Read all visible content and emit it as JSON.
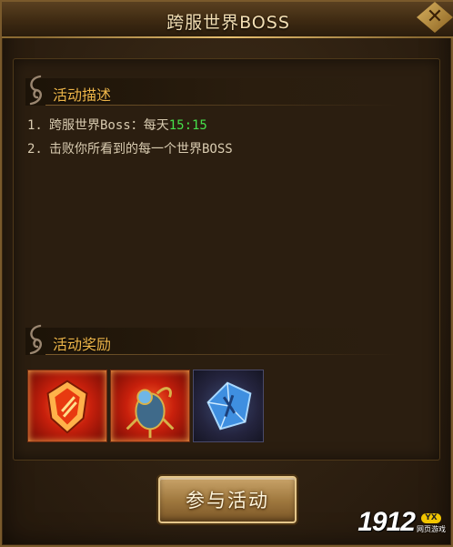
{
  "window": {
    "title": "跨服世界BOSS",
    "close_symbol": "✕"
  },
  "sections": {
    "description": {
      "title": "活动描述",
      "items": [
        {
          "num": "1.",
          "text": "跨服世界Boss：每天",
          "time": "15:15"
        },
        {
          "num": "2.",
          "text": "击败你所看到的每一个世界BOSS",
          "time": ""
        }
      ]
    },
    "rewards": {
      "title": "活动奖励",
      "items": [
        {
          "icon": "red-shield-emblem-icon"
        },
        {
          "icon": "red-scorpion-pet-icon"
        },
        {
          "icon": "blue-gem-stone-icon"
        }
      ]
    }
  },
  "join_button": {
    "label": "参与活动"
  },
  "watermark": {
    "text": "1912",
    "badge": "YX",
    "sub": "网页游戏"
  },
  "colors": {
    "accent_gold": "#f0b74a",
    "time_green": "#46e04a",
    "text": "#d8cbb0"
  }
}
